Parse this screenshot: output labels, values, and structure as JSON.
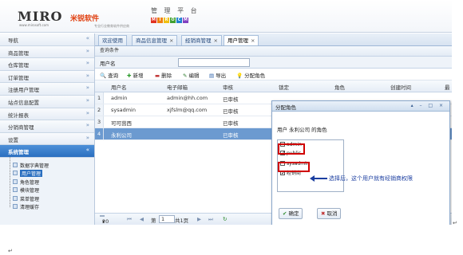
{
  "header": {
    "logo_text": "MIRO",
    "logo_cn": "米锐软件",
    "logo_url": "www.mirosoft.com",
    "slogan": "专业行业教育软件供应商",
    "platform_title": "管 理 平 台",
    "platform_logo_letters": [
      "M",
      "I",
      "R",
      "O",
      "C",
      "M"
    ],
    "platform_logo_colors": [
      "#e03020",
      "#f08010",
      "#f0c010",
      "#40a030",
      "#2080d0",
      "#8040c0"
    ]
  },
  "sidebar": {
    "items": [
      {
        "label": "导航",
        "chevron": "«"
      },
      {
        "label": "商品管理",
        "chevron": "»"
      },
      {
        "label": "仓库管理",
        "chevron": "»"
      },
      {
        "label": "订单管理",
        "chevron": "»"
      },
      {
        "label": "注册用户管理",
        "chevron": "»"
      },
      {
        "label": "站点信息配置",
        "chevron": "»"
      },
      {
        "label": "统计报表",
        "chevron": "»"
      },
      {
        "label": "分销商管理",
        "chevron": "»"
      },
      {
        "label": "设置",
        "chevron": "»"
      },
      {
        "label": "系统管理",
        "chevron": "«"
      }
    ],
    "tree": [
      "数据字典管理",
      "用户管理",
      "角色管理",
      "模块管理",
      "菜单管理",
      "清理缓存"
    ]
  },
  "tabs": [
    {
      "label": "欢迎使用",
      "closable": false
    },
    {
      "label": "商品信息管理",
      "closable": true
    },
    {
      "label": "经销商管理",
      "closable": true
    },
    {
      "label": "用户管理",
      "closable": true
    }
  ],
  "tab_close_glyph": "×",
  "panel_title": "查询条件",
  "search": {
    "label": "用户名",
    "value": ""
  },
  "toolbar": [
    {
      "icon": "search-icon",
      "glyph": "🔍",
      "label": "查询"
    },
    {
      "icon": "add-icon",
      "glyph": "✚",
      "label": "新增"
    },
    {
      "icon": "delete-icon",
      "glyph": "▬",
      "label": "删除"
    },
    {
      "icon": "edit-icon",
      "glyph": "✎",
      "label": "编辑"
    },
    {
      "icon": "export-icon",
      "glyph": "▤",
      "label": "导出"
    },
    {
      "icon": "role-icon",
      "glyph": "💡",
      "label": "分配角色"
    }
  ],
  "grid": {
    "columns": [
      "用户名",
      "电子邮箱",
      "审核",
      "锁定",
      "角色",
      "创建时间",
      "最"
    ],
    "rows": [
      {
        "num": "1",
        "username": "admin",
        "email": "admin@hh.com",
        "status": "已审核"
      },
      {
        "num": "2",
        "username": "sysadmin",
        "email": "xjfslm@qq.com",
        "status": "已审核"
      },
      {
        "num": "3",
        "username": "可可茵西",
        "email": "",
        "status": "已审核"
      },
      {
        "num": "4",
        "username": "永利公司",
        "email": "",
        "status": "已审核"
      }
    ]
  },
  "pager": {
    "page_size": "20",
    "dropdown_glyph": "▾",
    "page_label": "第",
    "page_value": "1",
    "total": "共1页",
    "first": "⏮",
    "prev": "◀",
    "next": "▶",
    "last": "⏭",
    "refresh": "↻"
  },
  "dialog": {
    "title": "分配角色",
    "controls": "▴ – □ ×",
    "subtitle": "用户 永利公司 的角色",
    "roles": [
      {
        "label": "admin",
        "checked": false
      },
      {
        "label": "public",
        "checked": true
      },
      {
        "label": "sysadmin",
        "checked": false
      },
      {
        "label": "经销商",
        "checked": true
      }
    ],
    "ok_icon": "✔",
    "ok_label": "确定",
    "cancel_icon": "✖",
    "cancel_label": "取消"
  },
  "annotation": {
    "text": "选择后，这个用户就有经销商权限",
    "color": "#1b3ea0",
    "highlight_color": "#d00000"
  },
  "return_marks": [
    "↵",
    "↵"
  ]
}
